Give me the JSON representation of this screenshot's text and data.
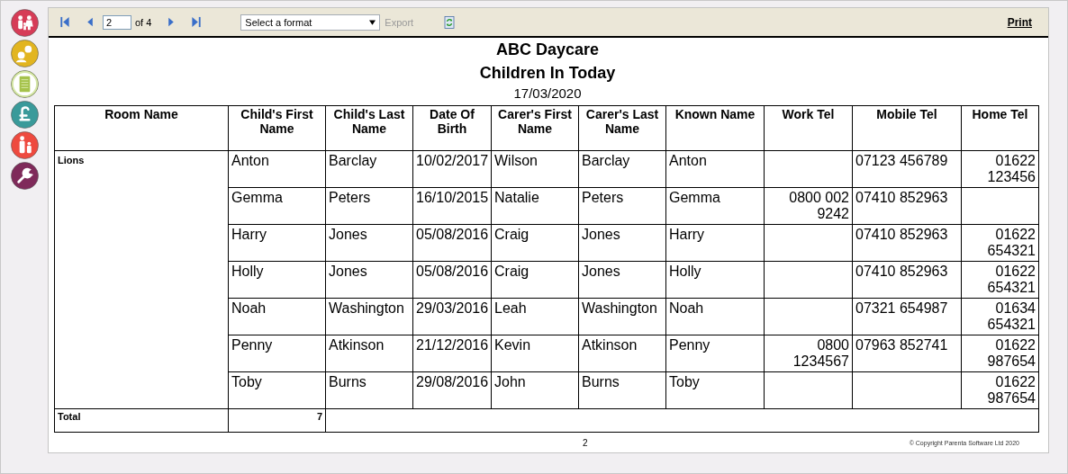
{
  "toolbar": {
    "page": "2",
    "page_count": "of 4",
    "format": {
      "placeholder": "Select a format"
    },
    "export": {
      "label": "Export",
      "disabled": true
    },
    "print": "Print"
  },
  "report": {
    "title": "ABC Daycare",
    "subtitle": "Children In Today",
    "date": "17/03/2020",
    "columns": [
      "Room Name",
      "Child's First Name",
      "Child's Last Name",
      "Date Of Birth",
      "Carer's First Name",
      "Carer's Last Name",
      "Known Name",
      "Work Tel",
      "Mobile Tel",
      "Home Tel"
    ],
    "groups": [
      {
        "room": "Lions",
        "rows": [
          [
            "Anton",
            "Barclay",
            "10/02/2017",
            "Wilson",
            "Barclay",
            "Anton",
            "",
            "07123 456789",
            "01622 123456"
          ],
          [
            "Gemma",
            "Peters",
            "16/10/2015",
            "Natalie",
            "Peters",
            "Gemma",
            "0800 002 9242",
            "07410 852963",
            ""
          ],
          [
            "Harry",
            "Jones",
            "05/08/2016",
            "Craig",
            "Jones",
            "Harry",
            "",
            "07410 852963",
            "01622 654321"
          ],
          [
            "Holly",
            "Jones",
            "05/08/2016",
            "Craig",
            "Jones",
            "Holly",
            "",
            "07410 852963",
            "01622 654321"
          ],
          [
            "Noah",
            "Washington",
            "29/03/2016",
            "Leah",
            "Washington",
            "Noah",
            "",
            "07321 654987",
            "01634 654321"
          ],
          [
            "Penny",
            "Atkinson",
            "21/12/2016",
            "Kevin",
            "Atkinson",
            "Penny",
            "0800 1234567",
            "07963 852741",
            "01622 987654"
          ],
          [
            "Toby",
            "Burns",
            "29/08/2016",
            "John",
            "Burns",
            "Toby",
            "",
            "",
            "01622 987654"
          ]
        ]
      }
    ],
    "total": {
      "label": "Total",
      "value": "7"
    },
    "footer": {
      "page": "2",
      "copyright": "© Copyright Parenta Software Ltd 2020"
    }
  }
}
